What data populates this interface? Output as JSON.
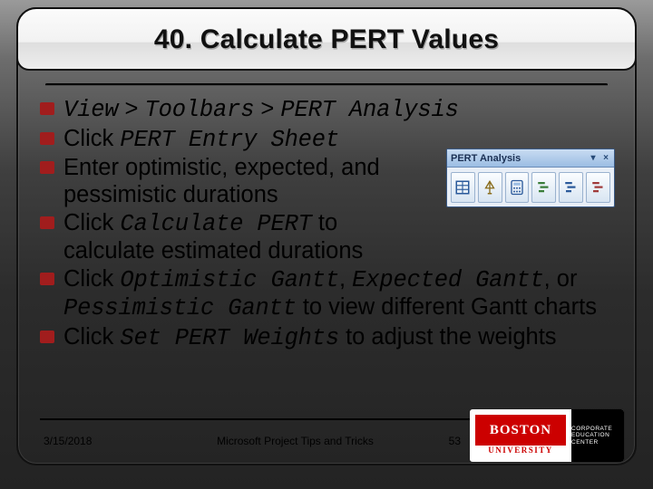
{
  "slide": {
    "title": "40. Calculate PERT Values",
    "bullets": [
      {
        "segments": [
          {
            "text": "View",
            "cls": "mono-it"
          },
          {
            "text": " > ",
            "cls": ""
          },
          {
            "text": "Toolbars",
            "cls": "mono-it"
          },
          {
            "text": " > ",
            "cls": ""
          },
          {
            "text": "PERT Analysis",
            "cls": "mono-it"
          }
        ]
      },
      {
        "segments": [
          {
            "text": "Click ",
            "cls": ""
          },
          {
            "text": "PERT Entry Sheet",
            "cls": "mono-it"
          }
        ]
      },
      {
        "wrap": "wrap1",
        "segments": [
          {
            "text": "Enter optimistic, expected, and pessimistic durations",
            "cls": ""
          }
        ]
      },
      {
        "wrap": "wrap1",
        "segments": [
          {
            "text": "Click ",
            "cls": ""
          },
          {
            "text": "Calculate PERT",
            "cls": "mono-it"
          },
          {
            "text": " to calculate estimated durations",
            "cls": ""
          }
        ]
      },
      {
        "segments": [
          {
            "text": "Click ",
            "cls": ""
          },
          {
            "text": "Optimistic Gantt",
            "cls": "mono-it"
          },
          {
            "text": ", ",
            "cls": ""
          },
          {
            "text": "Expected Gantt",
            "cls": "mono-it"
          },
          {
            "text": ", or ",
            "cls": ""
          },
          {
            "text": "Pessimistic Gantt",
            "cls": "mono-it"
          },
          {
            "text": " to view different Gantt charts",
            "cls": ""
          }
        ]
      },
      {
        "segments": [
          {
            "text": "Click ",
            "cls": ""
          },
          {
            "text": "Set PERT Weights",
            "cls": "mono-it"
          },
          {
            "text": " to adjust the weights",
            "cls": ""
          }
        ]
      }
    ],
    "toolbar_label": "PERT Analysis",
    "toolbar_icons": [
      "entry-sheet-icon",
      "weights-icon",
      "calculate-icon",
      "optimistic-gantt-icon",
      "expected-gantt-icon",
      "pessimistic-gantt-icon"
    ]
  },
  "footer": {
    "date": "3/15/2018",
    "title": "Microsoft Project Tips and Tricks",
    "page": "53"
  },
  "logo": {
    "brand": "BOSTON",
    "sub": "UNIVERSITY",
    "dept": "CORPORATE EDUCATION CENTER"
  }
}
